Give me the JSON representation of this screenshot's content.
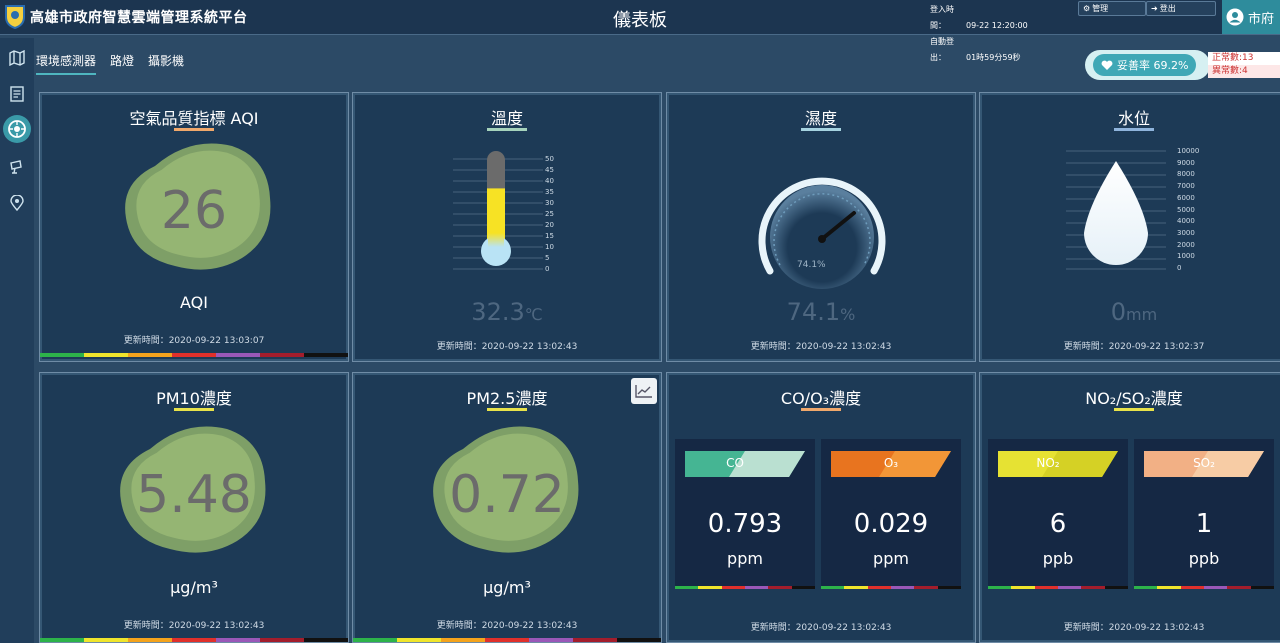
{
  "header": {
    "app_title": "高雄市政府智慧雲端管理系統平台",
    "page_title": "儀表板",
    "login_time_label": "登入時間：",
    "login_time": "09-22 12:20:00",
    "auto_logout_label": "自動登出：",
    "auto_logout": "01時59分59秒",
    "admin_label": "管理",
    "logout_label": "登出",
    "user_label": "市府"
  },
  "tabs": [
    "環境感測器",
    "路燈",
    "攝影機"
  ],
  "health": {
    "label": "妥善率 69.2%",
    "normal": "正常數:13",
    "abnormal": "異常數:4"
  },
  "colors": {
    "bg": "#2c4a66",
    "card": "#1d3a56",
    "accent": "#3fa8b6",
    "blob": "#8fb26a"
  },
  "cards": {
    "aqi": {
      "title": "空氣品質指標 AQI",
      "value": "26",
      "unit": "AQI",
      "updated": "更新時間：2020-09-22 13:03:07"
    },
    "temp": {
      "title": "溫度",
      "value": "32.3",
      "unit": "℃",
      "updated": "更新時間：2020-09-22 13:02:43",
      "scale": [
        "50",
        "45",
        "40",
        "35",
        "30",
        "25",
        "20",
        "15",
        "10",
        "5",
        "0"
      ],
      "level": 0.646
    },
    "humidity": {
      "title": "濕度",
      "value": "74.1",
      "unit": "%",
      "updated": "更新時間：2020-09-22 13:02:43",
      "dial_value": "74.1%",
      "dial_ticks": [
        "0",
        "10",
        "20",
        "30",
        "40",
        "50",
        "60",
        "70",
        "80",
        "90",
        "100"
      ]
    },
    "water": {
      "title": "水位",
      "value": "0",
      "unit": "mm",
      "updated": "更新時間：2020-09-22 13:02:37",
      "scale": [
        "10000",
        "9000",
        "8000",
        "7000",
        "6000",
        "5000",
        "4000",
        "3000",
        "2000",
        "1000",
        "0"
      ]
    },
    "pm10": {
      "title": "PM10濃度",
      "value": "5.48",
      "unit": "μg/m³",
      "updated": "更新時間：2020-09-22 13:02:43"
    },
    "pm25": {
      "title": "PM2.5濃度",
      "value": "0.72",
      "unit": "μg/m³",
      "updated": "更新時間：2020-09-22 13:02:43"
    },
    "co_o3": {
      "title": "CO/O₃濃度",
      "updated": "更新時間：2020-09-22 13:02:43",
      "a": {
        "label": "CO",
        "value": "0.793",
        "unit": "ppm",
        "color": "#45b593"
      },
      "b": {
        "label": "O₃",
        "value": "0.029",
        "unit": "ppm",
        "color": "#e8741f"
      }
    },
    "no2_so2": {
      "title": "NO₂/SO₂濃度",
      "updated": "更新時間：2020-09-22 13:02:43",
      "a": {
        "label": "NO₂",
        "value": "6",
        "unit": "ppb",
        "color": "#e6e233"
      },
      "b": {
        "label": "SO₂",
        "value": "1",
        "unit": "ppb",
        "color": "#f2b085"
      }
    }
  }
}
